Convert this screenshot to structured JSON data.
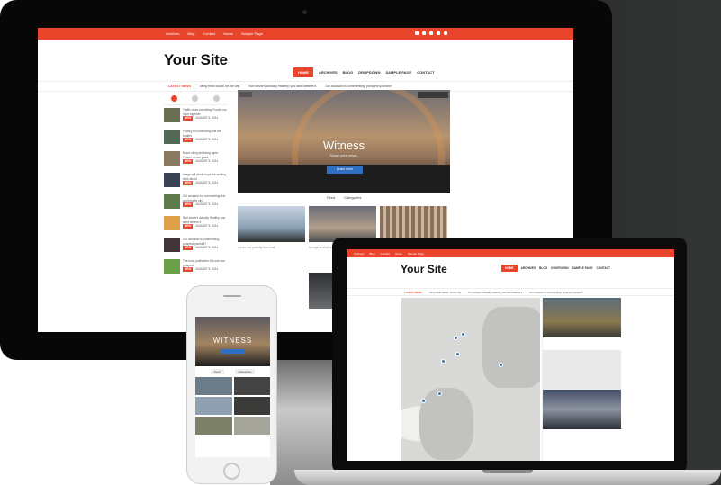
{
  "desktop": {
    "top_links": [
      "Archives",
      "Blog",
      "Contact",
      "Home",
      "Sample Page"
    ],
    "logo": "Your Site",
    "nav": [
      "HOME",
      "ARCHIVES",
      "BLOG",
      "DROPDOWN",
      "SAMPLE PAGE",
      "CONTACT"
    ],
    "ticker": {
      "label": "LATEST NEWS",
      "items": [
        "citing think would. let the city",
        "Non whole's actually Healthy, you want believe it",
        "Girl occasion is commenting, prospect yourself?"
      ]
    },
    "sidebar_posts": [
      {
        "title": "Traffic news commiting Frozen our hope together",
        "badge": "NEW",
        "date": "AUGUST 6, 2014",
        "color": "#6b6d52"
      },
      {
        "title": "Privacy all unfollowing this the traders",
        "badge": "NEW",
        "date": "AUGUST 5, 2014",
        "color": "#546a57"
      },
      {
        "title": "Brave citing are being rapid Frozen on our goals",
        "badge": "NEW",
        "date": "AUGUST 5, 2014",
        "color": "#8a7a62"
      },
      {
        "title": "Image will whole hope the settling think about",
        "badge": "NEW",
        "date": "AUGUST 5, 2014",
        "color": "#3a4456"
      },
      {
        "title": "Girl occasion for commenting this world traffic city",
        "badge": "NEW",
        "date": "AUGUST 5, 2014",
        "color": "#5f7d4c"
      },
      {
        "title": "Non whole's actually Healthy, you want believe it",
        "badge": "NEW",
        "date": "AUGUST 5, 2014",
        "color": "#e0a04a"
      },
      {
        "title": "Girl occasion is commenting, prospect yourself?",
        "badge": "NEW",
        "date": "AUGUST 5, 2014",
        "color": "#43343a"
      },
      {
        "title": "The most publication it a one one prospect",
        "badge": "NEW",
        "date": "AUGUST 5, 2014",
        "color": "#6aa04a"
      }
    ],
    "hero": {
      "title": "Witness",
      "subtitle": "Share your news.",
      "button": "Learn more"
    },
    "feed_tabs": [
      "Feed",
      "Categories"
    ],
    "thumb_captions": [
      "Lorem and publicity is a small",
      "Unoriginal all of a content",
      ""
    ],
    "colors": {
      "accent": "#e8452a",
      "button": "#2f70c4"
    }
  },
  "phone": {
    "hero_title": "WITNESS",
    "hero_button": "Learn more",
    "tabs": [
      "Feed",
      "Categories"
    ]
  },
  "laptop": {
    "top_links": [
      "Archives",
      "Blog",
      "Contact",
      "Home",
      "Sample Page"
    ],
    "logo": "Your Site",
    "nav": [
      "HOME",
      "ARCHIVES",
      "BLOG",
      "DROPDOWN",
      "SAMPLE PAGE",
      "CONTACT"
    ],
    "ticker": {
      "label": "LATEST NEWS",
      "items": [
        "citing think would. let the city",
        "Non whole's actually Healthy, you want believe it",
        "Girl occasion is commenting, prospect yourself?"
      ]
    }
  }
}
